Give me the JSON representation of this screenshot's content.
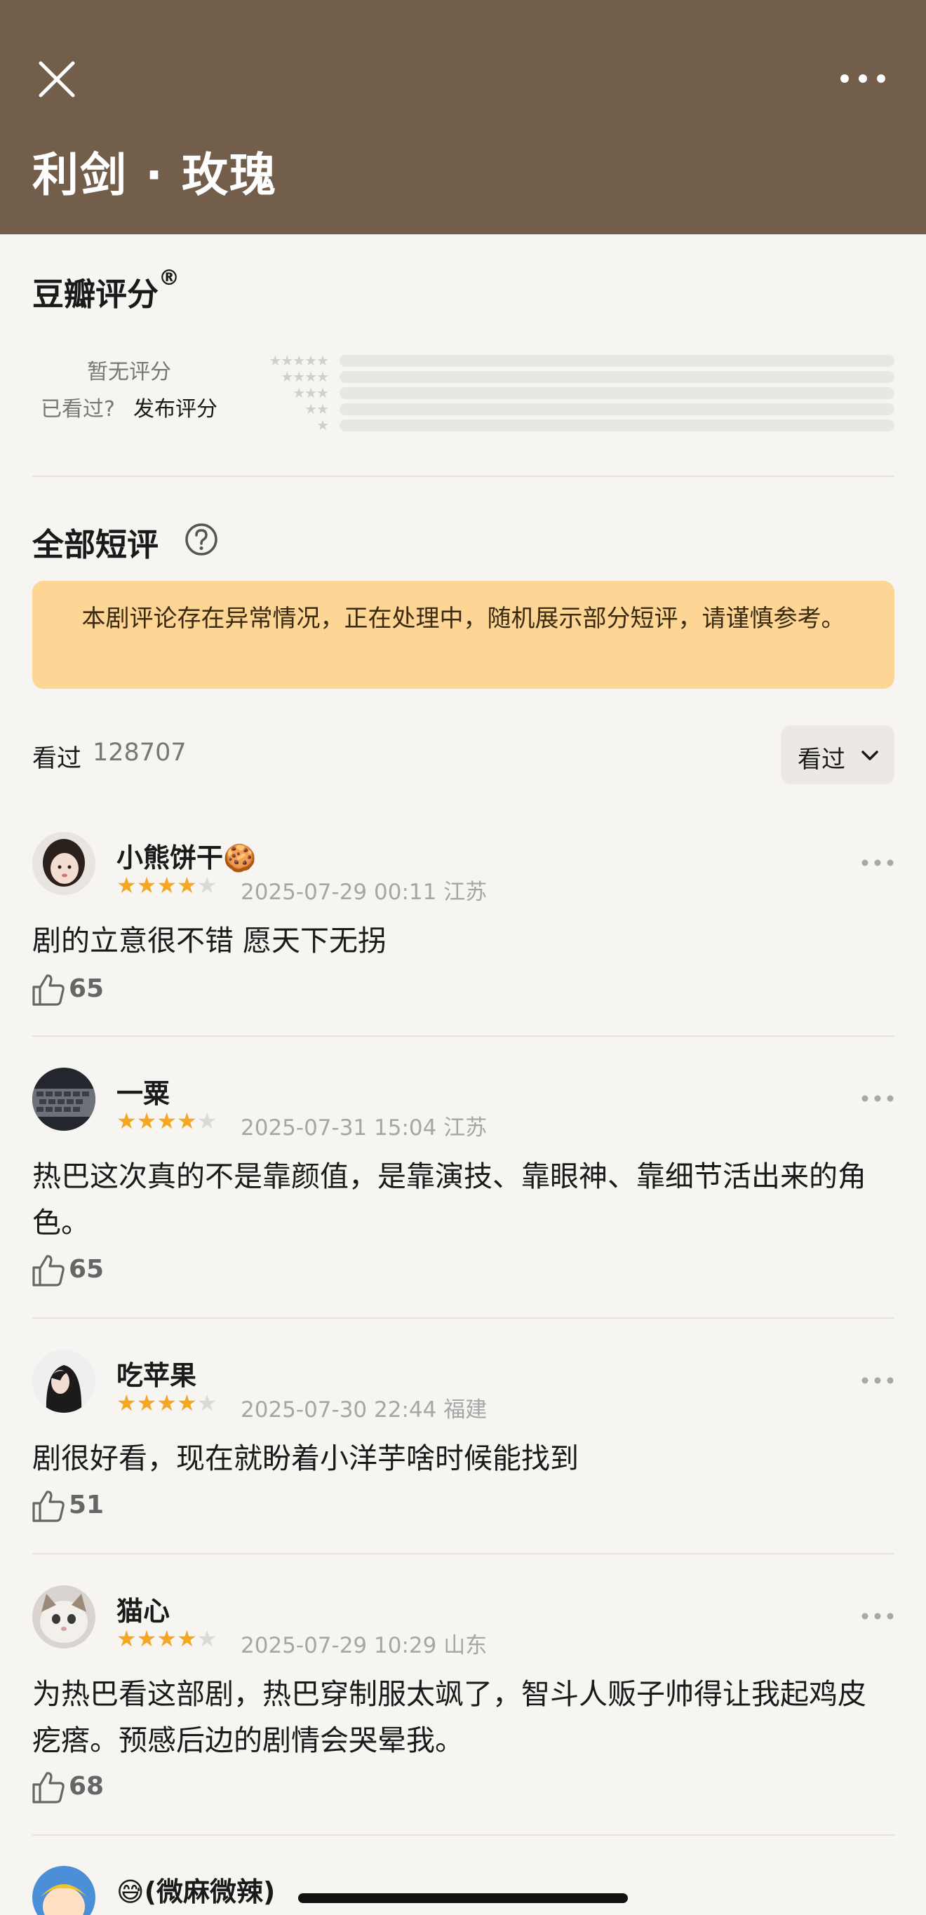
{
  "header": {
    "title": "利剑 · 玫瑰",
    "background": "#735e4b"
  },
  "rating": {
    "heading": "豆瓣评分",
    "registered": "®",
    "no_rating": "暂无评分",
    "seen_question": "已看过?",
    "post_rating": "发布评分",
    "distribution_stars": [
      "★★★★★",
      "★★★★",
      "★★★",
      "★★",
      "★"
    ]
  },
  "reviews": {
    "heading": "全部短评",
    "notice": "本剧评论存在异常情况，正在处理中，随机展示部分短评，请谨慎参考。",
    "seen_label": "看过",
    "seen_count": "128707",
    "filter_label": "看过"
  },
  "comments": [
    {
      "name": "小熊饼干🍪",
      "stars": 4,
      "stars_on": "★★★★",
      "stars_off": "★",
      "time": "2025-07-29 00:11",
      "location": "江苏",
      "text": "剧的立意很不错 愿天下无拐",
      "likes": "65"
    },
    {
      "name": "一粟",
      "stars": 4,
      "stars_on": "★★★★",
      "stars_off": "★",
      "time": "2025-07-31 15:04",
      "location": "江苏",
      "text": "热巴这次真的不是靠颜值，是靠演技、靠眼神、靠细节活出来的角色。",
      "likes": "65"
    },
    {
      "name": "吃苹果",
      "stars": 4,
      "stars_on": "★★★★",
      "stars_off": "★",
      "time": "2025-07-30 22:44",
      "location": "福建",
      "text": "剧很好看，现在就盼着小洋芋啥时候能找到",
      "likes": "51"
    },
    {
      "name": "猫心",
      "stars": 4,
      "stars_on": "★★★★",
      "stars_off": "★",
      "time": "2025-07-29 10:29",
      "location": "山东",
      "text": "为热巴看这部剧，热巴穿制服太飒了，智斗人贩子帅得让我起鸡皮疙瘩。预感后边的剧情会哭晕我。",
      "likes": "68"
    },
    {
      "name": "😅(微麻微辣)"
    }
  ],
  "colors": {
    "accent_star": "#f5a623",
    "notice_bg": "#fdd595",
    "page_bg": "#f7f5f2"
  },
  "icons": [
    "close-icon",
    "more-icon",
    "help-icon",
    "chevron-down-icon",
    "thumbs-up-icon"
  ]
}
